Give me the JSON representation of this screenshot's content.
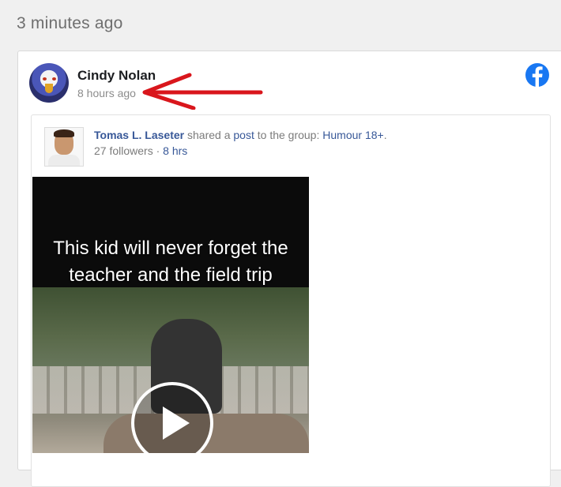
{
  "feed": {
    "top_timestamp": "3 minutes ago"
  },
  "post": {
    "author": "Cindy Nolan",
    "time": "8 hours ago",
    "source_icon": "facebook-icon",
    "annotation_color": "#d9161c"
  },
  "shared_post": {
    "sharer_name": "Tomas L. Laseter",
    "shared_a": " shared a ",
    "post_link": "post",
    "to_group": " to the group: ",
    "group_name": "Humour 18+",
    "period": ".",
    "followers": "27 followers",
    "separator": " · ",
    "time": "8 hrs"
  },
  "video": {
    "caption": "This kid will never forget the teacher and the field trip",
    "play_icon": "play-icon"
  },
  "colors": {
    "link": "#385898",
    "facebook_blue": "#1877f2"
  }
}
